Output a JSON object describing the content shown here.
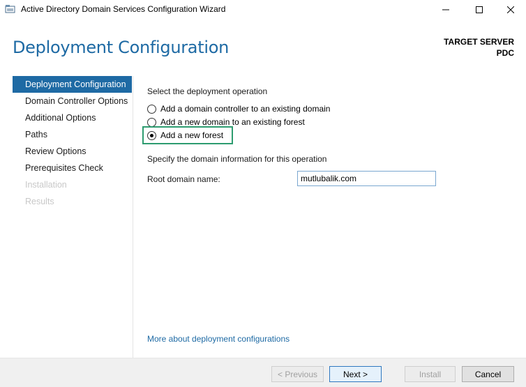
{
  "window": {
    "title": "Active Directory Domain Services Configuration Wizard"
  },
  "header": {
    "page_title": "Deployment Configuration",
    "target_server_label": "TARGET SERVER",
    "target_server_name": "PDC"
  },
  "nav": {
    "items": [
      {
        "label": "Deployment Configuration",
        "state": "active"
      },
      {
        "label": "Domain Controller Options",
        "state": "enabled"
      },
      {
        "label": "Additional Options",
        "state": "enabled"
      },
      {
        "label": "Paths",
        "state": "enabled"
      },
      {
        "label": "Review Options",
        "state": "enabled"
      },
      {
        "label": "Prerequisites Check",
        "state": "enabled"
      },
      {
        "label": "Installation",
        "state": "disabled"
      },
      {
        "label": "Results",
        "state": "disabled"
      }
    ]
  },
  "main": {
    "operation_label": "Select the deployment operation",
    "options": [
      {
        "label": "Add a domain controller to an existing domain",
        "checked": false
      },
      {
        "label": "Add a new domain to an existing forest",
        "checked": false
      },
      {
        "label": "Add a new forest",
        "checked": true
      }
    ],
    "domain_info_label": "Specify the domain information for this operation",
    "root_domain_label": "Root domain name:",
    "root_domain_value": "mutlubalik.com",
    "more_link": "More about deployment configurations"
  },
  "footer": {
    "previous_label": "< Previous",
    "next_label": "Next >",
    "install_label": "Install",
    "cancel_label": "Cancel"
  },
  "colors": {
    "accent": "#1e6aa4",
    "highlight": "#2e9c70",
    "disabled_text": "#c8c8c8"
  }
}
